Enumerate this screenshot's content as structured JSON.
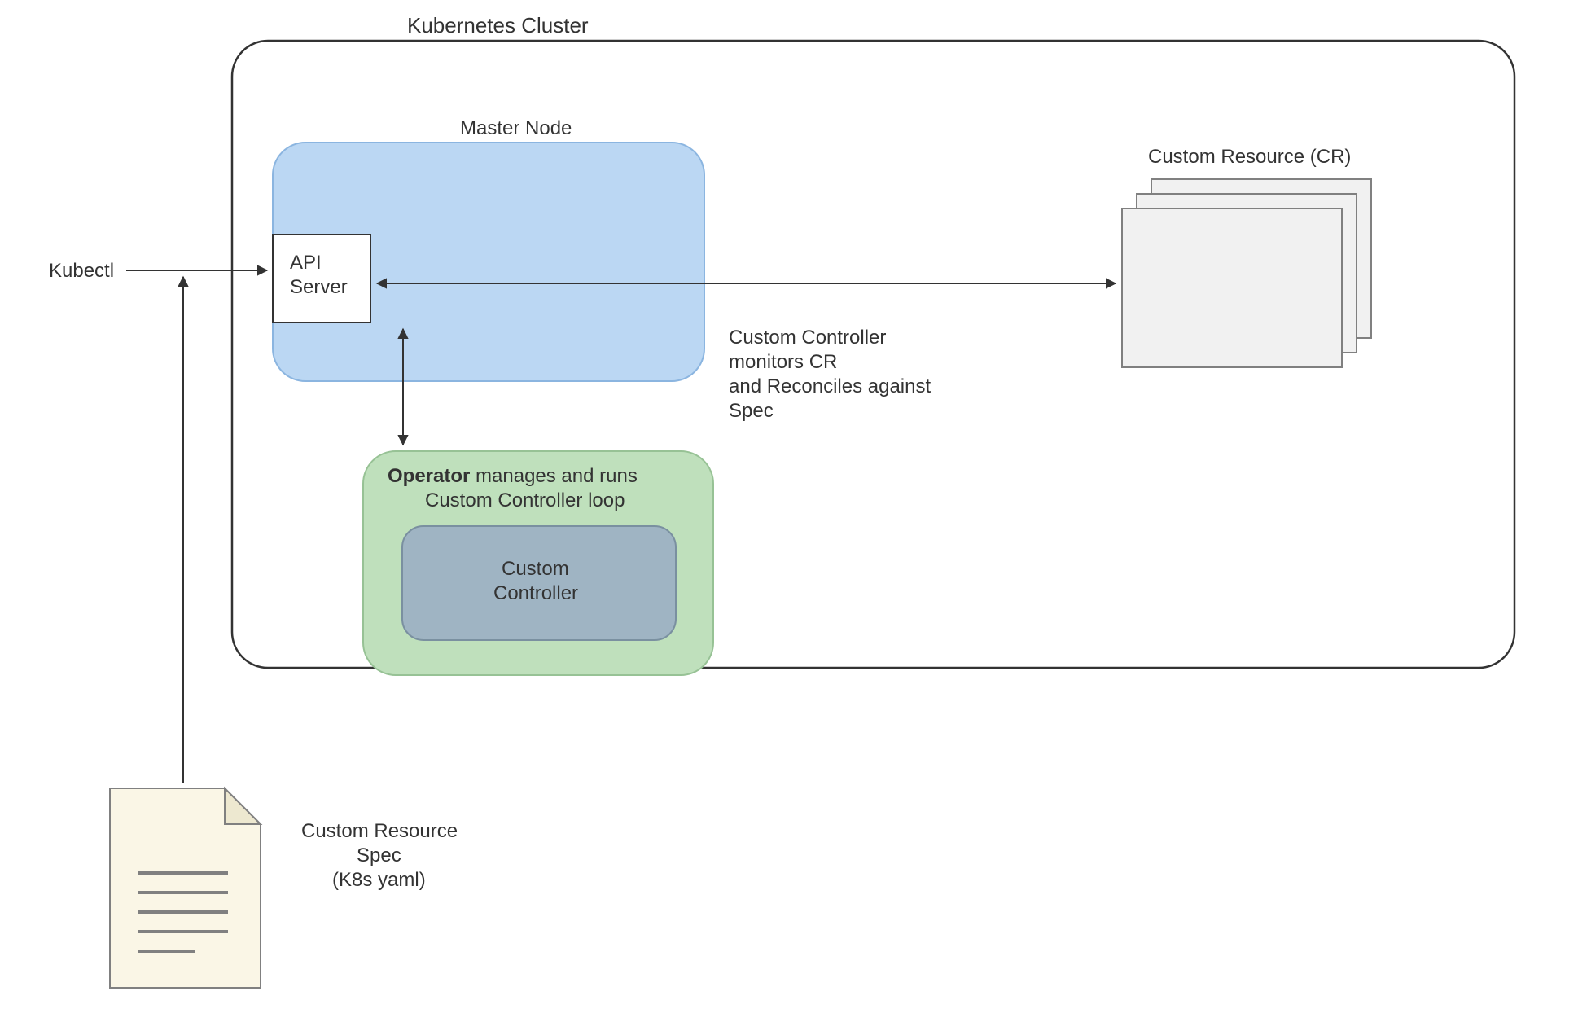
{
  "cluster_title": "Kubernetes Cluster",
  "master_node_label": "Master Node",
  "api_server": {
    "line1": "API",
    "line2": "Server"
  },
  "kubectl_label": "Kubectl",
  "operator_box": {
    "bold": "Operator",
    "rest1": " manages and runs",
    "line2": "Custom Controller loop"
  },
  "custom_controller": {
    "line1": "Custom",
    "line2": "Controller"
  },
  "cr_title": "Custom Resource (CR)",
  "monitor_text": {
    "l1": "Custom Controller",
    "l2": "monitors CR",
    "l3": "and Reconciles against",
    "l4": "Spec"
  },
  "spec_label": {
    "l1": "Custom Resource",
    "l2": "Spec",
    "l3": "(K8s yaml)"
  },
  "colors": {
    "master_fill": "#BBD7F3",
    "master_stroke": "#8BB5E0",
    "operator_fill": "#BFE0BC",
    "operator_stroke": "#97C295",
    "controller_fill": "#9FB4C3",
    "controller_stroke": "#7A90A0",
    "cr_fill": "#F1F1F1",
    "cr_stroke": "#808080",
    "file_fill": "#FAF6E6",
    "file_stroke": "#808080",
    "line": "#333333"
  }
}
